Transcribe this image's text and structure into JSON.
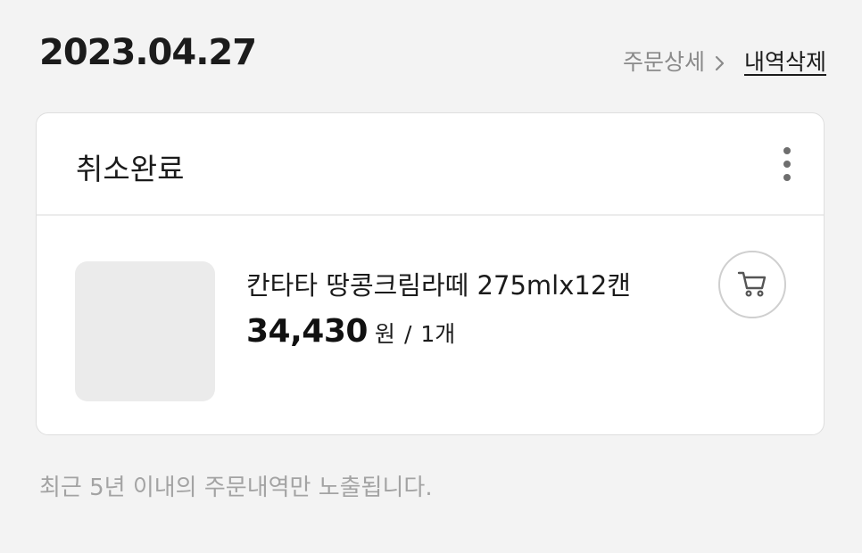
{
  "order": {
    "date": "2023.04.27",
    "detail_label": "주문상세",
    "delete_label": "내역삭제"
  },
  "card": {
    "status": "취소완료",
    "product": {
      "name": "칸타타 땅콩크림라떼 275mlx12캔",
      "price": "34,430",
      "price_unit": "원",
      "separator": "/",
      "quantity": "1개"
    }
  },
  "notice": "최근 5년 이내의 주문내역만 노출됩니다.",
  "icons": {
    "chevron": "chevron-right-icon",
    "more": "more-vertical-icon",
    "cart": "cart-icon"
  }
}
